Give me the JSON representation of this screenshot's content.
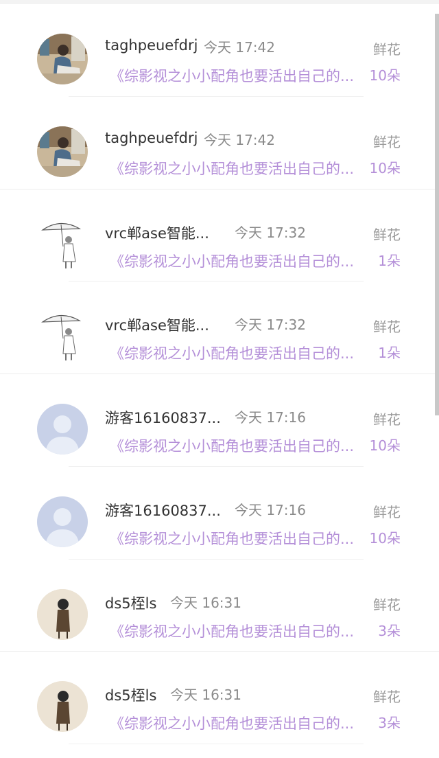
{
  "colors": {
    "username": "#333333",
    "time": "#8a8a8a",
    "gift_label": "#9a9a9a",
    "accent_purple": "#b48fd8"
  },
  "gifts": [
    {
      "username": "taghpeuefdrj",
      "time": "今天 17:42",
      "gift_label": "鲜花",
      "book_title": "《综影视之小小配角也要活出自己的...",
      "count": "10朵",
      "avatar": "photo-sitting-avatar"
    },
    {
      "username": "taghpeuefdrj",
      "time": "今天 17:42",
      "gift_label": "鲜花",
      "book_title": "《综影视之小小配角也要活出自己的...",
      "count": "10朵",
      "avatar": "photo-sitting-avatar"
    },
    {
      "username": "vrc郸ase智能...",
      "time": "今天 17:32",
      "gift_label": "鲜花",
      "book_title": "《综影视之小小配角也要活出自己的...",
      "count": "1朵",
      "avatar": "umbrella-sketch-avatar"
    },
    {
      "username": "vrc郸ase智能...",
      "time": "今天 17:32",
      "gift_label": "鲜花",
      "book_title": "《综影视之小小配角也要活出自己的...",
      "count": "1朵",
      "avatar": "umbrella-sketch-avatar"
    },
    {
      "username": "游客16160837...",
      "time": "今天 17:16",
      "gift_label": "鲜花",
      "book_title": "《综影视之小小配角也要活出自己的...",
      "count": "10朵",
      "avatar": "default-user-avatar"
    },
    {
      "username": "游客16160837...",
      "time": "今天 17:16",
      "gift_label": "鲜花",
      "book_title": "《综影视之小小配角也要活出自己的...",
      "count": "10朵",
      "avatar": "default-user-avatar"
    },
    {
      "username": "ds5桎ls",
      "time": "今天 16:31",
      "gift_label": "鲜花",
      "book_title": "《综影视之小小配角也要活出自己的...",
      "count": "3朵",
      "avatar": "girl-beanie-avatar"
    },
    {
      "username": "ds5桎ls",
      "time": "今天 16:31",
      "gift_label": "鲜花",
      "book_title": "《综影视之小小配角也要活出自己的...",
      "count": "3朵",
      "avatar": "girl-beanie-avatar"
    }
  ]
}
